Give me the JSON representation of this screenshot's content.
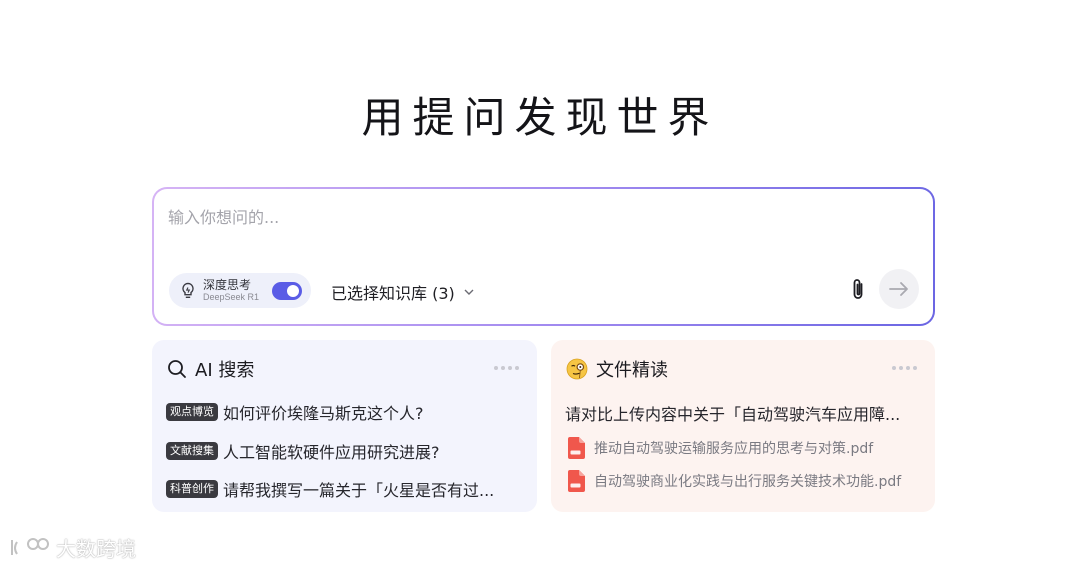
{
  "hero": {
    "title": "用提问发现世界"
  },
  "input": {
    "placeholder": "输入你想问的...",
    "deep_think": {
      "title": "深度思考",
      "model": "DeepSeek R1",
      "enabled": true
    },
    "knowledge_base": "已选择知识库 (3)"
  },
  "cards": {
    "search": {
      "title": "AI 搜索",
      "items": [
        {
          "tag": "观点博览",
          "text": "如何评价埃隆马斯克这个人?"
        },
        {
          "tag": "文献搜集",
          "text": "人工智能软硬件应用研究进展?"
        },
        {
          "tag": "科普创作",
          "text": "请帮我撰写一篇关于「火星是否有过..."
        }
      ]
    },
    "reader": {
      "title": "文件精读",
      "question": "请对比上传内容中关于「自动驾驶汽车应用障...",
      "files": [
        {
          "name": "推动自动驾驶运输服务应用的思考与对策.pdf"
        },
        {
          "name": "自动驾驶商业化实践与出行服务关键技术功能.pdf"
        }
      ]
    }
  },
  "watermark": {
    "text": "大数跨境"
  },
  "colors": {
    "accent": "#5a5ce6",
    "search_card_bg": "#f3f4fd",
    "reader_card_bg": "#fdf3f0",
    "pdf_red": "#f0574c"
  },
  "icons": [
    "lightbulb-icon",
    "chevron-down-icon",
    "paperclip-icon",
    "arrow-right-icon",
    "search-icon",
    "monocle-emoji-icon",
    "pdf-file-icon",
    "more-dots-icon"
  ]
}
